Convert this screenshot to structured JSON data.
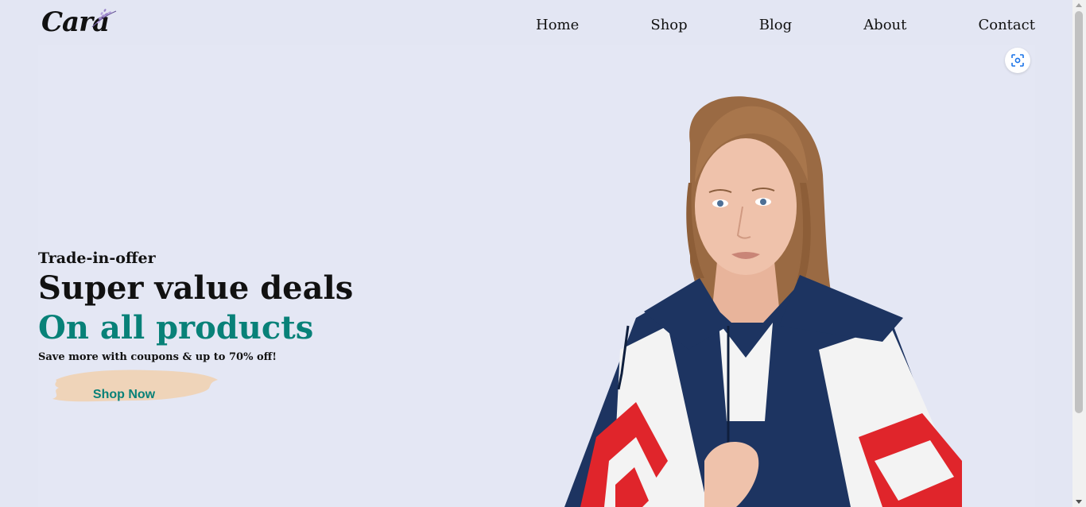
{
  "header": {
    "logo_text": "Cara",
    "nav": [
      {
        "label": "Home"
      },
      {
        "label": "Shop"
      },
      {
        "label": "Blog"
      },
      {
        "label": "About"
      },
      {
        "label": "Contact"
      }
    ]
  },
  "hero": {
    "eyebrow": "Trade-in-offer",
    "headline": "Super value deals",
    "headline_accent": "On all products",
    "subtext": "Save more with coupons & up to 70% off!",
    "cta_label": "Shop Now"
  },
  "colors": {
    "accent": "#088178",
    "background": "#e3e6f3",
    "cta_brush": "#efd4b9"
  },
  "icons": {
    "lens": "lens-search-icon",
    "logo_flower": "lavender-icon"
  }
}
